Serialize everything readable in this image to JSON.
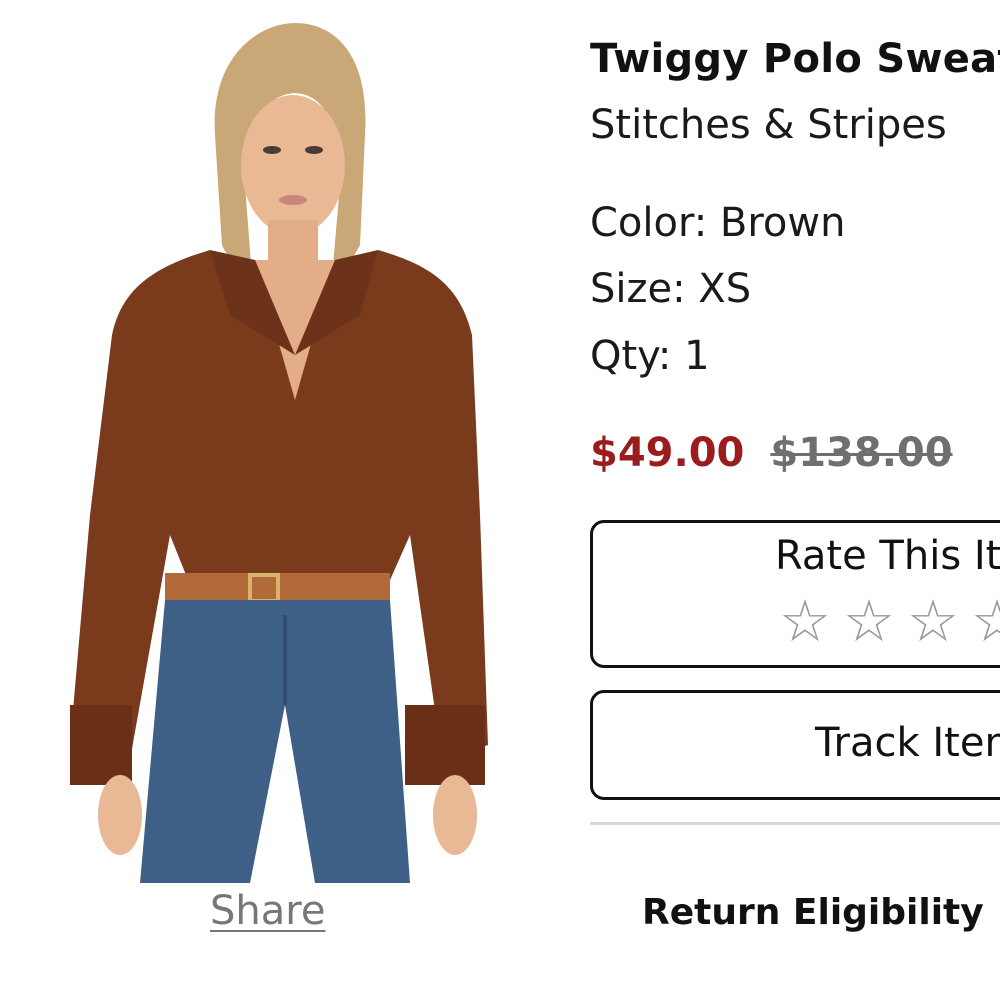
{
  "product": {
    "title": "Twiggy Polo Sweater",
    "brand": "Stitches & Stripes",
    "color": "Color: Brown",
    "size": "Size: XS",
    "qty": "Qty: 1",
    "price_sale": "$49.00",
    "price_original": "$138.00",
    "image_alt": "Model wearing brown polo sweater with fringe cuffs and blue jeans"
  },
  "actions": {
    "share_label": "Share",
    "rate_label": "Rate This Item",
    "rating": {
      "value": 0,
      "max": 5
    },
    "stars": [
      "☆",
      "☆",
      "☆",
      "☆",
      "☆"
    ],
    "track_label": "Track Item",
    "return_label": "Return Eligibility"
  },
  "colors": {
    "sale_price": "#9b1c1c",
    "original_price": "#6f6f6f",
    "sweater": "#7a3a1c",
    "denim": "#3e5f86"
  },
  "icons": {
    "star": "star-outline-icon"
  }
}
